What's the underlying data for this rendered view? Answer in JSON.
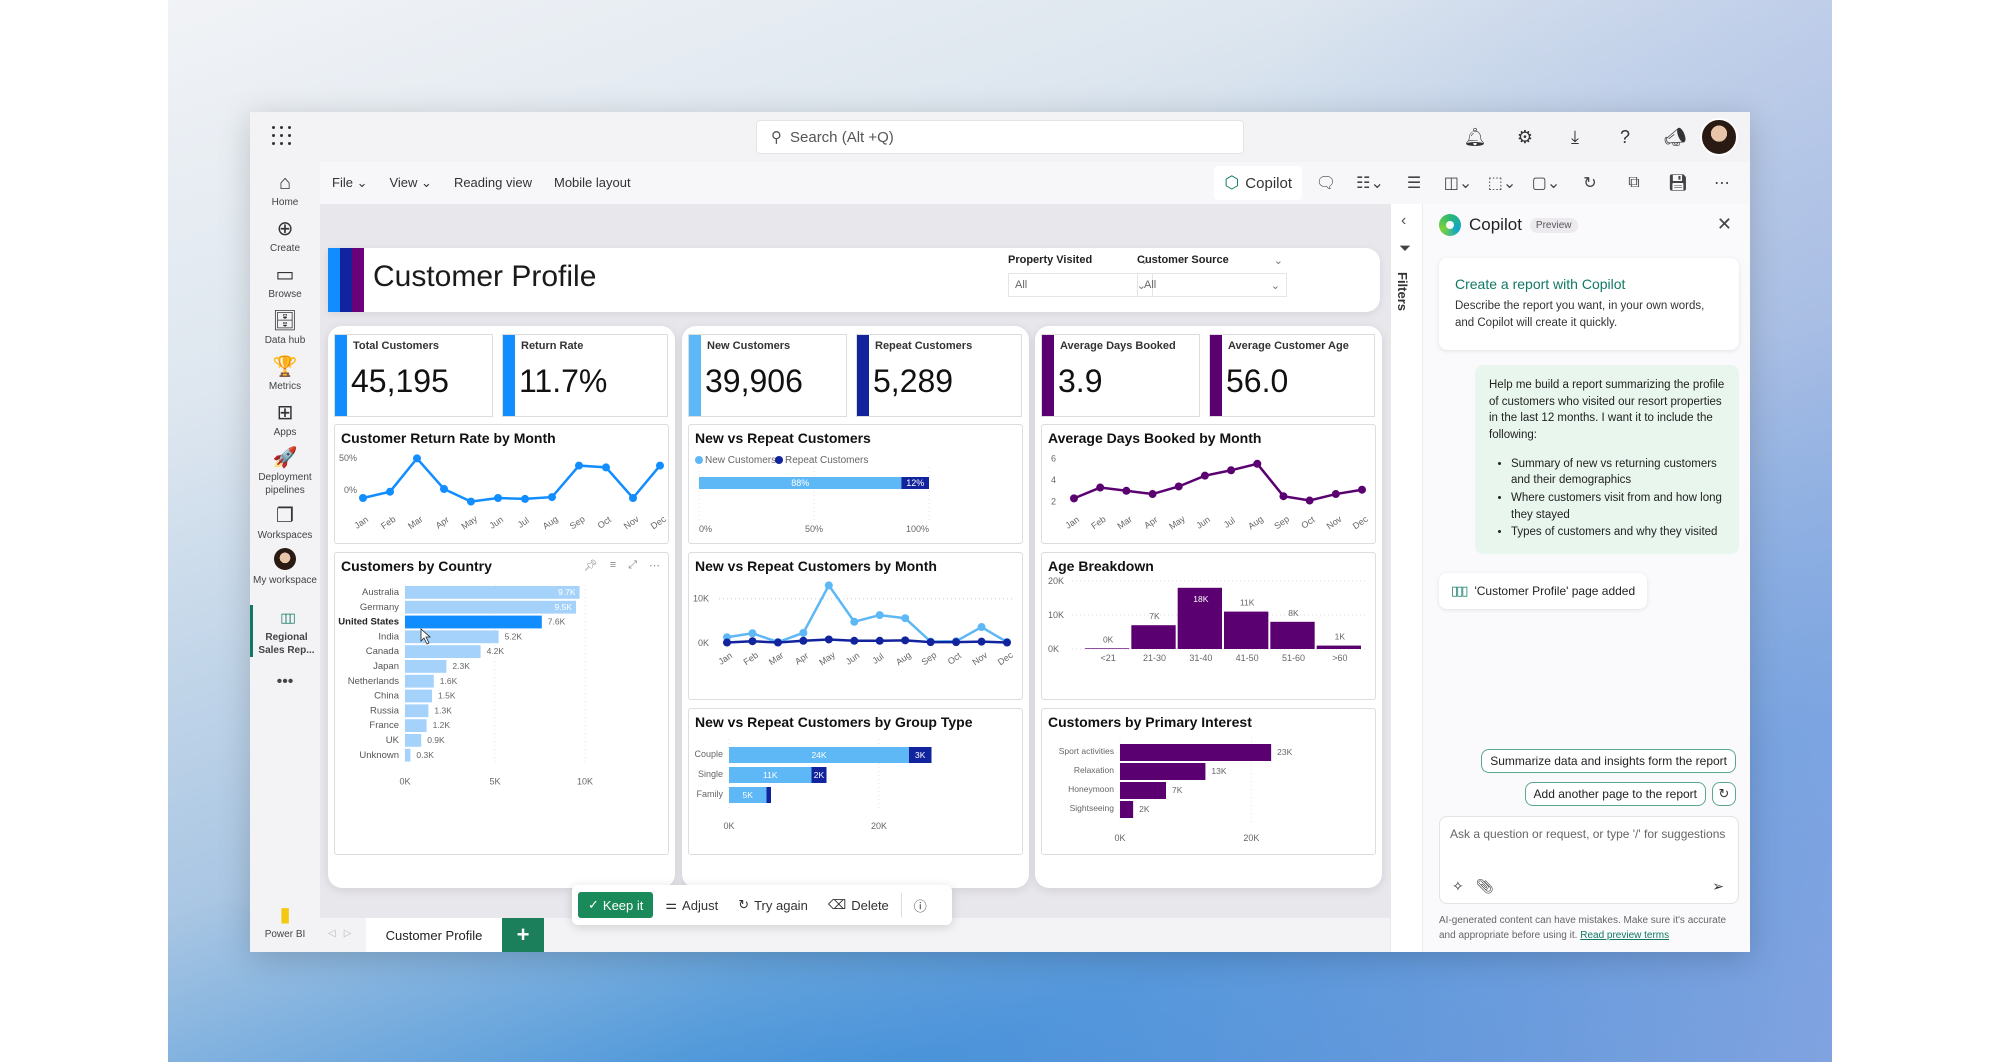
{
  "app": {
    "search_placeholder": "Search (Alt +Q)",
    "top_icons": [
      "bell-icon",
      "gear-icon",
      "download-icon",
      "help-icon",
      "feedback-icon"
    ]
  },
  "nav": {
    "items": [
      {
        "label": "Home",
        "icon": "home-icon",
        "glyph": "⌂"
      },
      {
        "label": "Create",
        "icon": "create-icon",
        "glyph": "⊕"
      },
      {
        "label": "Browse",
        "icon": "folder-icon",
        "glyph": "▭"
      },
      {
        "label": "Data hub",
        "icon": "data-hub-icon",
        "glyph": "🗄"
      },
      {
        "label": "Metrics",
        "icon": "trophy-icon",
        "glyph": "🏆"
      },
      {
        "label": "Apps",
        "icon": "apps-icon",
        "glyph": "⊞"
      },
      {
        "label": "Deployment pipelines",
        "icon": "rocket-icon",
        "glyph": "🚀"
      },
      {
        "label": "Workspaces",
        "icon": "workspaces-icon",
        "glyph": "❐"
      },
      {
        "label": "My workspace",
        "icon": "avatar",
        "glyph": ""
      },
      {
        "label": "Regional Sales Rep...",
        "icon": "report-icon",
        "glyph": "▯▯▯"
      }
    ],
    "more": "•••",
    "brand": "Power BI"
  },
  "ribbon": {
    "file": "File",
    "view": "View",
    "reading_view": "Reading view",
    "mobile_layout": "Mobile layout",
    "copilot": "Copilot"
  },
  "report": {
    "title": "Customer Profile",
    "stripe_colors": [
      "#118DFF",
      "#12239E",
      "#6B007B"
    ],
    "slicers": [
      {
        "label": "Property Visited",
        "value": "All"
      },
      {
        "label": "Customer Source",
        "value": "All"
      }
    ],
    "kpis": [
      {
        "label": "Total Customers",
        "value": "45,195",
        "color": "#118DFF"
      },
      {
        "label": "Return Rate",
        "value": "11.7%",
        "color": "#118DFF"
      },
      {
        "label": "New Customers",
        "value": "39,906",
        "color": "#5DB8F5"
      },
      {
        "label": "Repeat Customers",
        "value": "5,289",
        "color": "#12239E"
      },
      {
        "label": "Average Days Booked",
        "value": "3.9",
        "color": "#5A0070"
      },
      {
        "label": "Average Customer Age",
        "value": "56.0",
        "color": "#5A0070"
      }
    ]
  },
  "chart_data": [
    {
      "id": "return-rate",
      "type": "line",
      "title": "Customer Return Rate by Month",
      "categories": [
        "Jan",
        "Feb",
        "Mar",
        "Apr",
        "May",
        "Jun",
        "Jul",
        "Aug",
        "Sep",
        "Oct",
        "Nov",
        "Dec"
      ],
      "values": [
        10,
        17,
        54,
        20,
        6,
        10,
        9,
        11,
        46,
        44,
        10,
        46
      ],
      "yticks": [
        "0%",
        "50%"
      ],
      "ylim": [
        0,
        60
      ],
      "color": "#118DFF"
    },
    {
      "id": "new-vs-repeat",
      "type": "bar",
      "title": "New vs Repeat Customers",
      "legend": [
        {
          "name": "New Customers",
          "color": "#5DB8F5"
        },
        {
          "name": "Repeat Customers",
          "color": "#12239E"
        }
      ],
      "series": [
        {
          "name": "New Customers",
          "values": [
            88
          ],
          "label": "88%"
        },
        {
          "name": "Repeat Customers",
          "values": [
            12
          ],
          "label": "12%"
        }
      ],
      "xticks": [
        "0%",
        "50%",
        "100%"
      ]
    },
    {
      "id": "avg-days",
      "type": "line",
      "title": "Average Days Booked by Month",
      "categories": [
        "Jan",
        "Feb",
        "Mar",
        "Apr",
        "May",
        "Jun",
        "Jul",
        "Aug",
        "Sep",
        "Oct",
        "Nov",
        "Dec"
      ],
      "values": [
        2.3,
        3.3,
        3.0,
        2.7,
        3.4,
        4.4,
        4.9,
        5.5,
        2.5,
        2.1,
        2.7,
        3.1
      ],
      "yticks": [
        "2",
        "4",
        "6"
      ],
      "ylim": [
        1.5,
        6.5
      ],
      "color": "#5A0070"
    },
    {
      "id": "by-country",
      "type": "bar",
      "title": "Customers by Country",
      "categories": [
        "Australia",
        "Germany",
        "United States",
        "India",
        "Canada",
        "Japan",
        "Netherlands",
        "China",
        "Russia",
        "France",
        "UK",
        "Unknown"
      ],
      "values": [
        9.7,
        9.5,
        7.6,
        5.2,
        4.2,
        2.3,
        1.6,
        1.5,
        1.3,
        1.2,
        0.9,
        0.3
      ],
      "labels": [
        "9.7K",
        "9.5K",
        "7.6K",
        "5.2K",
        "4.2K",
        "2.3K",
        "1.6K",
        "1.5K",
        "1.3K",
        "1.2K",
        "0.9K",
        "0.3K"
      ],
      "highlight": "United States",
      "xticks": [
        "0K",
        "5K",
        "10K"
      ],
      "xlim": [
        0,
        10
      ],
      "color": "#A5D2FB",
      "highlight_color": "#118DFF"
    },
    {
      "id": "by-month",
      "type": "line",
      "title": "New vs Repeat Customers by Month",
      "categories": [
        "Jan",
        "Feb",
        "Mar",
        "Apr",
        "May",
        "Jun",
        "Jul",
        "Aug",
        "Sep",
        "Oct",
        "Nov",
        "Dec"
      ],
      "series": [
        {
          "name": "New Customers",
          "values": [
            1.3,
            2.2,
            0.2,
            2.3,
            13,
            4.8,
            6.3,
            5.6,
            0.3,
            0.4,
            3.6,
            0.2
          ],
          "color": "#5DB8F5"
        },
        {
          "name": "Repeat Customers",
          "values": [
            0.1,
            0.4,
            0.1,
            0.5,
            0.8,
            0.5,
            0.5,
            0.6,
            0.2,
            0.2,
            0.3,
            0.1
          ],
          "color": "#12239E"
        }
      ],
      "yticks": [
        "0K",
        "10K"
      ],
      "ylim": [
        0,
        14
      ]
    },
    {
      "id": "by-group",
      "type": "bar",
      "title": "New vs Repeat Customers by Group Type",
      "categories": [
        "Couple",
        "Single",
        "Family"
      ],
      "series": [
        {
          "name": "New Customers",
          "values": [
            24,
            11,
            5
          ],
          "labels": [
            "24K",
            "11K",
            "5K"
          ],
          "color": "#5DB8F5"
        },
        {
          "name": "Repeat Customers",
          "values": [
            3,
            2,
            0.6
          ],
          "labels": [
            "3K",
            "2K",
            ""
          ],
          "color": "#12239E"
        }
      ],
      "xticks": [
        "0K",
        "20K"
      ],
      "xlim": [
        0,
        32
      ]
    },
    {
      "id": "age",
      "type": "bar",
      "title": "Age Breakdown",
      "categories": [
        "<21",
        "21-30",
        "31-40",
        "41-50",
        "51-60",
        ">60"
      ],
      "values": [
        0.2,
        7,
        18,
        11,
        8,
        1
      ],
      "labels": [
        "0K",
        "7K",
        "18K",
        "11K",
        "8K",
        "1K"
      ],
      "yticks": [
        "0K",
        "10K",
        "20K"
      ],
      "ylim": [
        0,
        20
      ],
      "color": "#5A0070"
    },
    {
      "id": "interest",
      "type": "bar",
      "title": "Customers by Primary Interest",
      "categories": [
        "Sport activities",
        "Relaxation",
        "Honeymoon",
        "Sightseeing"
      ],
      "values": [
        23,
        13,
        7,
        2
      ],
      "labels": [
        "23K",
        "13K",
        "7K",
        "2K"
      ],
      "xticks": [
        "0K",
        "20K"
      ],
      "xlim": [
        0,
        28
      ],
      "color": "#5A0070"
    }
  ],
  "actionbar": {
    "keep": "Keep it",
    "adjust": "Adjust",
    "try_again": "Try again",
    "delete": "Delete"
  },
  "tabs": {
    "page": "Customer Profile",
    "add": "+"
  },
  "filters": {
    "label": "Filters"
  },
  "copilot": {
    "title": "Copilot",
    "badge": "Preview",
    "card_title": "Create a report with Copilot",
    "card_text": "Describe the report you want, in your own words, and Copilot will create it quickly.",
    "user_msg": "Help me build a report summarizing the profile of customers who visited our resort properties in the last 12 months. I want it to include the following:",
    "user_bullets": [
      "Summary of new vs returning customers and their demographics",
      "Where customers visit from and how long they stayed",
      "Types of customers and why they visited"
    ],
    "page_added": "'Customer Profile' page added",
    "suggestions": [
      "Summarize data and insights form the report",
      "Add another page to the report"
    ],
    "input_placeholder": "Ask a question or request, or type '/' for suggestions",
    "disclaimer": "AI-generated content can have mistakes. Make sure it's accurate and appropriate before using it.",
    "terms_link": "Read preview terms"
  }
}
